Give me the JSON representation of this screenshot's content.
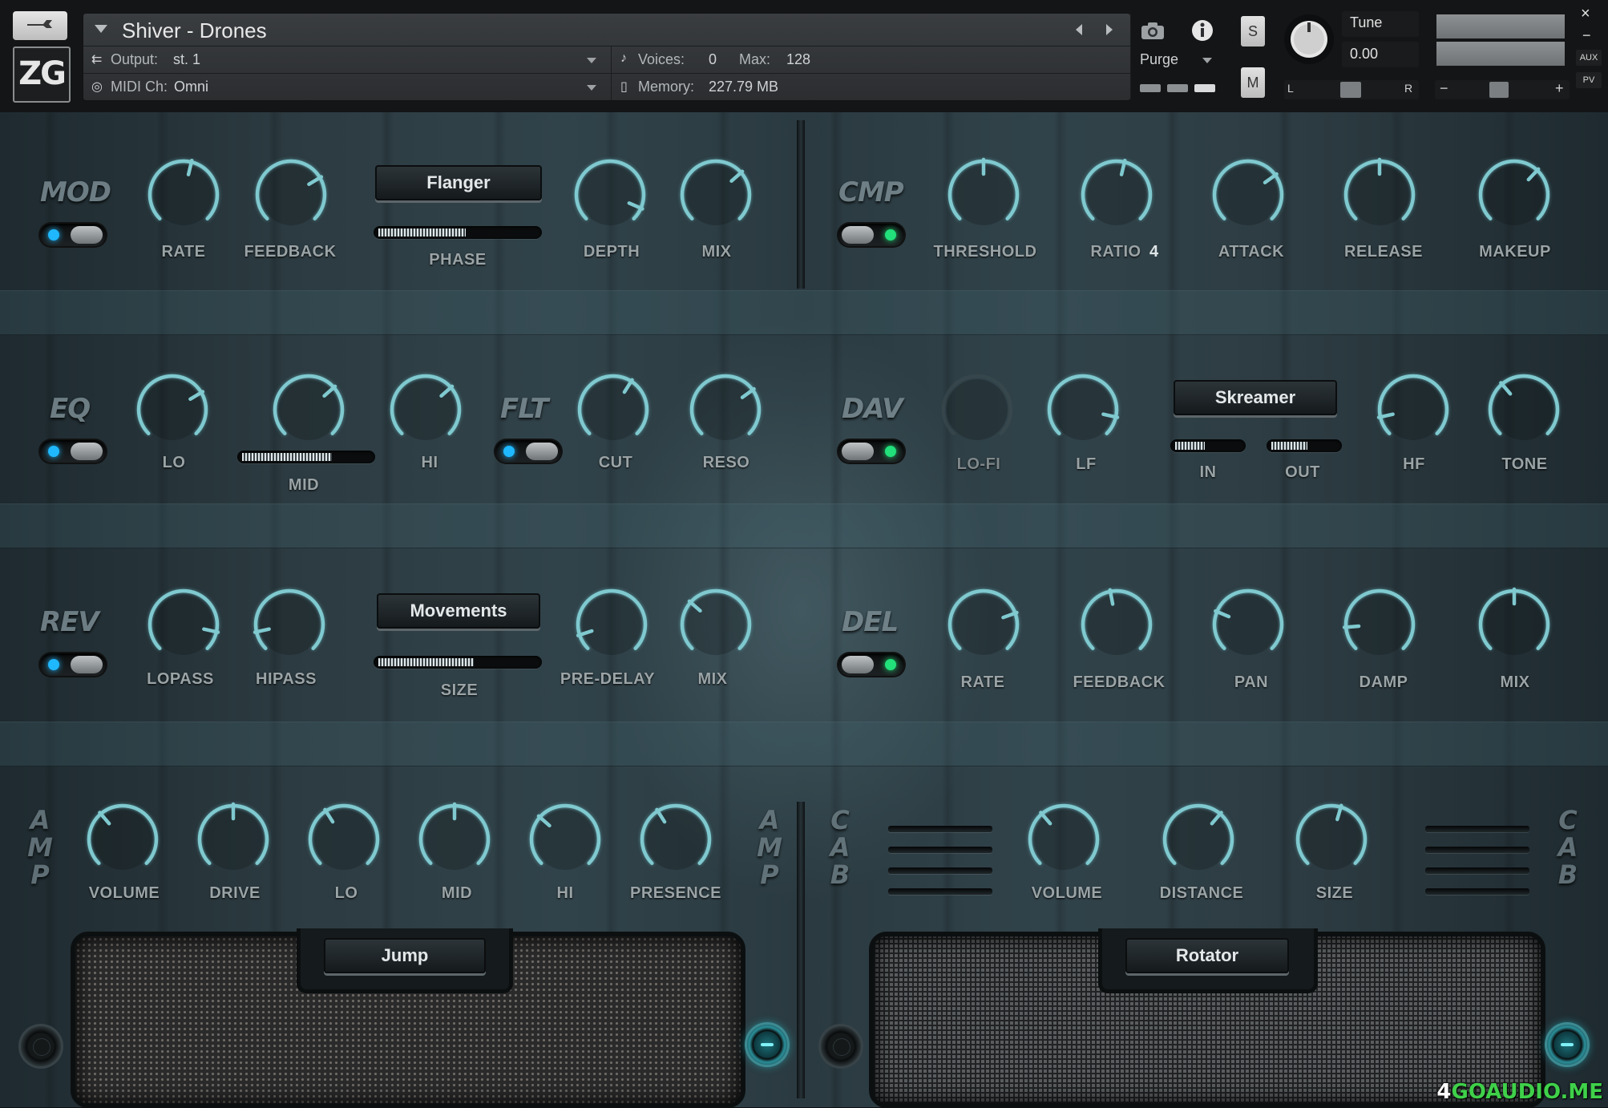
{
  "header": {
    "instrument_title": "Shiver - Drones",
    "logo_text": "ZG",
    "output_label": "Output:",
    "output_value": "st. 1",
    "midi_label": "MIDI Ch:",
    "midi_value": "Omni",
    "voices_label": "Voices:",
    "voices_value": "0",
    "max_label": "Max:",
    "max_value": "128",
    "memory_label": "Memory:",
    "memory_value": "227.79 MB",
    "purge_label": "Purge",
    "solo_label": "S",
    "mute_label": "M",
    "tune_label": "Tune",
    "tune_value": "0.00",
    "pan_left": "L",
    "pan_right": "R",
    "vol_minus": "−",
    "vol_plus": "+",
    "aux_label": "AUX",
    "pv_label": "PV",
    "close_glyph": "×",
    "minimize_glyph": "−"
  },
  "sections": {
    "mod": {
      "label": "MOD",
      "enabled": true,
      "effect": "Flanger",
      "knobs": {
        "rate": "RATE",
        "feedback": "FEEDBACK",
        "depth": "DEPTH",
        "mix": "MIX"
      },
      "slider_label": "PHASE",
      "slider_value": 0.55
    },
    "cmp": {
      "label": "CMP",
      "enabled": true,
      "knobs": {
        "threshold": "THRESHOLD",
        "ratio": "RATIO",
        "attack": "ATTACK",
        "release": "RELEASE",
        "makeup": "MAKEUP"
      },
      "ratio_value": "4"
    },
    "eq": {
      "label": "EQ",
      "enabled": true,
      "knobs": {
        "lo": "LO",
        "hi": "HI"
      },
      "slider_label": "MID",
      "slider_value": 0.7
    },
    "flt": {
      "label": "FLT",
      "enabled": true,
      "knobs": {
        "cut": "CUT",
        "reso": "RESO"
      }
    },
    "dav": {
      "label": "DAV",
      "enabled": true,
      "effect": "Skreamer",
      "knobs": {
        "lofi": "LO-FI",
        "lf": "LF",
        "hf": "HF",
        "tone": "TONE"
      },
      "in_label": "IN",
      "in_value": 0.45,
      "out_label": "OUT",
      "out_value": 0.55
    },
    "rev": {
      "label": "REV",
      "enabled": true,
      "effect": "Movements",
      "knobs": {
        "lopass": "LOPASS",
        "hipass": "HIPASS",
        "predelay": "PRE-DELAY",
        "mix": "MIX"
      },
      "slider_label": "SIZE",
      "slider_value": 0.6
    },
    "del": {
      "label": "DEL",
      "enabled": true,
      "knobs": {
        "rate": "RATE",
        "feedback": "FEEDBACK",
        "pan": "PAN",
        "damp": "DAMP",
        "mix": "MIX"
      }
    },
    "amp": {
      "label_left": [
        "A",
        "M",
        "P"
      ],
      "label_right": [
        "A",
        "M",
        "P"
      ],
      "preset": "Jump",
      "knobs": {
        "volume": "VOLUME",
        "drive": "DRIVE",
        "lo": "LO",
        "mid": "MID",
        "hi": "HI",
        "presence": "PRESENCE"
      }
    },
    "cab": {
      "label_left": [
        "C",
        "A",
        "B"
      ],
      "label_right": [
        "C",
        "A",
        "B"
      ],
      "preset": "Rotator",
      "knobs": {
        "volume": "VOLUME",
        "distance": "DISTANCE",
        "size": "SIZE"
      }
    }
  },
  "watermark": {
    "prefix": "4",
    "text": "GOAUDIO.ME"
  },
  "colors": {
    "knob_arc": "#7fc9cf",
    "led_blue": "#1fb8ff",
    "led_green": "#22e07a",
    "text_label": "#9aa3a6"
  }
}
